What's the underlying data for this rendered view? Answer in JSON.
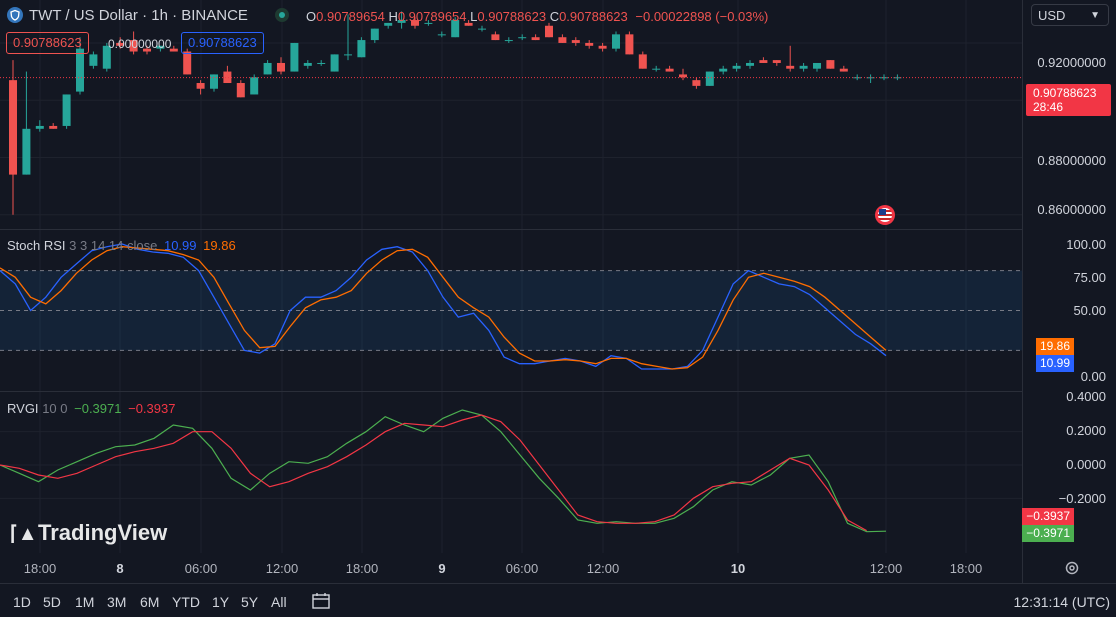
{
  "header": {
    "symbol": "TWT / US Dollar · 1h · BINANCE",
    "o_label": "O",
    "o_value": "0.90789654",
    "h_label": "H",
    "h_value": "0.90789654",
    "l_label": "L",
    "l_value": "0.90788623",
    "c_label": "C",
    "c_value": "0.90788623",
    "change": "−0.00022898 (−0.03%)",
    "sell_price": "0.90788623",
    "spread": "0.00000000",
    "buy_price": "0.90788623"
  },
  "currency_select": "USD",
  "price_axis": {
    "ticks": [
      "0.92000000",
      "0.90000000",
      "0.88000000",
      "0.86000000"
    ],
    "last_price": "0.90788623",
    "countdown": "28:46"
  },
  "stoch_rsi": {
    "title": "Stoch RSI",
    "params": "3 3 14 14 close",
    "k_value": "10.99",
    "d_value": "19.86",
    "ticks": [
      "100.00",
      "75.00",
      "50.00",
      "0.00"
    ]
  },
  "rvgi": {
    "title": "RVGI",
    "params": "10 0",
    "v1": "−0.3971",
    "v2": "−0.3937",
    "ticks": [
      "0.4000",
      "0.2000",
      "0.0000",
      "−0.2000"
    ]
  },
  "time_axis": {
    "labels": [
      {
        "t": "18:00",
        "bold": false
      },
      {
        "t": "8",
        "bold": true
      },
      {
        "t": "06:00",
        "bold": false
      },
      {
        "t": "12:00",
        "bold": false
      },
      {
        "t": "18:00",
        "bold": false
      },
      {
        "t": "9",
        "bold": true
      },
      {
        "t": "06:00",
        "bold": false
      },
      {
        "t": "12:00",
        "bold": false
      },
      {
        "t": "10",
        "bold": true
      },
      {
        "t": "12:00",
        "bold": false
      },
      {
        "t": "18:00",
        "bold": false
      }
    ]
  },
  "bottom_bar": {
    "ranges": [
      "1D",
      "5D",
      "1M",
      "3M",
      "6M",
      "YTD",
      "1Y",
      "5Y",
      "All"
    ],
    "clock": "12:31:14 (UTC)"
  },
  "watermark": "TradingView",
  "colors": {
    "up": "#26a69a",
    "down": "#ef5350",
    "k_line": "#2962ff",
    "d_line": "#ff6d00",
    "rvgi_1": "#4caf50",
    "rvgi_2": "#f23645"
  },
  "chart_data": [
    {
      "type": "candlestick",
      "title": "TWT / US Dollar · 1h · BINANCE",
      "ylim": [
        0.855,
        0.935
      ],
      "candles": [
        {
          "o": 0.907,
          "h": 0.914,
          "l": 0.86,
          "c": 0.874
        },
        {
          "o": 0.874,
          "h": 0.91,
          "l": 0.874,
          "c": 0.89
        },
        {
          "o": 0.89,
          "h": 0.893,
          "l": 0.889,
          "c": 0.891
        },
        {
          "o": 0.891,
          "h": 0.892,
          "l": 0.89,
          "c": 0.89
        },
        {
          "o": 0.891,
          "h": 0.902,
          "l": 0.89,
          "c": 0.902
        },
        {
          "o": 0.903,
          "h": 0.922,
          "l": 0.902,
          "c": 0.918
        },
        {
          "o": 0.912,
          "h": 0.917,
          "l": 0.911,
          "c": 0.916
        },
        {
          "o": 0.911,
          "h": 0.92,
          "l": 0.91,
          "c": 0.919
        },
        {
          "o": 0.92,
          "h": 0.922,
          "l": 0.918,
          "c": 0.919
        },
        {
          "o": 0.921,
          "h": 0.924,
          "l": 0.916,
          "c": 0.917
        },
        {
          "o": 0.918,
          "h": 0.919,
          "l": 0.916,
          "c": 0.917
        },
        {
          "o": 0.918,
          "h": 0.919,
          "l": 0.917,
          "c": 0.919
        },
        {
          "o": 0.918,
          "h": 0.919,
          "l": 0.917,
          "c": 0.917
        },
        {
          "o": 0.917,
          "h": 0.918,
          "l": 0.909,
          "c": 0.909
        },
        {
          "o": 0.906,
          "h": 0.907,
          "l": 0.902,
          "c": 0.904
        },
        {
          "o": 0.904,
          "h": 0.909,
          "l": 0.903,
          "c": 0.909
        },
        {
          "o": 0.91,
          "h": 0.912,
          "l": 0.906,
          "c": 0.906
        },
        {
          "o": 0.906,
          "h": 0.907,
          "l": 0.901,
          "c": 0.901
        },
        {
          "o": 0.902,
          "h": 0.909,
          "l": 0.902,
          "c": 0.908
        },
        {
          "o": 0.909,
          "h": 0.914,
          "l": 0.909,
          "c": 0.913
        },
        {
          "o": 0.913,
          "h": 0.915,
          "l": 0.909,
          "c": 0.91
        },
        {
          "o": 0.91,
          "h": 0.92,
          "l": 0.91,
          "c": 0.92
        },
        {
          "o": 0.912,
          "h": 0.914,
          "l": 0.911,
          "c": 0.913
        },
        {
          "o": 0.913,
          "h": 0.914,
          "l": 0.912,
          "c": 0.913
        },
        {
          "o": 0.91,
          "h": 0.916,
          "l": 0.91,
          "c": 0.916
        },
        {
          "o": 0.916,
          "h": 0.93,
          "l": 0.914,
          "c": 0.916
        },
        {
          "o": 0.915,
          "h": 0.922,
          "l": 0.915,
          "c": 0.921
        },
        {
          "o": 0.921,
          "h": 0.925,
          "l": 0.92,
          "c": 0.925
        },
        {
          "o": 0.926,
          "h": 0.927,
          "l": 0.925,
          "c": 0.927
        },
        {
          "o": 0.927,
          "h": 0.931,
          "l": 0.925,
          "c": 0.928
        },
        {
          "o": 0.928,
          "h": 0.929,
          "l": 0.925,
          "c": 0.926
        },
        {
          "o": 0.927,
          "h": 0.928,
          "l": 0.926,
          "c": 0.927
        },
        {
          "o": 0.923,
          "h": 0.924,
          "l": 0.922,
          "c": 0.923
        },
        {
          "o": 0.922,
          "h": 0.929,
          "l": 0.922,
          "c": 0.928
        },
        {
          "o": 0.927,
          "h": 0.928,
          "l": 0.926,
          "c": 0.926
        },
        {
          "o": 0.925,
          "h": 0.926,
          "l": 0.924,
          "c": 0.925
        },
        {
          "o": 0.923,
          "h": 0.924,
          "l": 0.921,
          "c": 0.921
        },
        {
          "o": 0.921,
          "h": 0.922,
          "l": 0.92,
          "c": 0.921
        },
        {
          "o": 0.922,
          "h": 0.923,
          "l": 0.921,
          "c": 0.922
        },
        {
          "o": 0.922,
          "h": 0.923,
          "l": 0.921,
          "c": 0.921
        },
        {
          "o": 0.926,
          "h": 0.927,
          "l": 0.922,
          "c": 0.922
        },
        {
          "o": 0.922,
          "h": 0.923,
          "l": 0.92,
          "c": 0.92
        },
        {
          "o": 0.921,
          "h": 0.922,
          "l": 0.919,
          "c": 0.92
        },
        {
          "o": 0.92,
          "h": 0.921,
          "l": 0.918,
          "c": 0.919
        },
        {
          "o": 0.919,
          "h": 0.92,
          "l": 0.917,
          "c": 0.918
        },
        {
          "o": 0.918,
          "h": 0.924,
          "l": 0.917,
          "c": 0.923
        },
        {
          "o": 0.923,
          "h": 0.924,
          "l": 0.916,
          "c": 0.916
        },
        {
          "o": 0.916,
          "h": 0.917,
          "l": 0.911,
          "c": 0.911
        },
        {
          "o": 0.911,
          "h": 0.912,
          "l": 0.91,
          "c": 0.911
        },
        {
          "o": 0.911,
          "h": 0.912,
          "l": 0.91,
          "c": 0.91
        },
        {
          "o": 0.909,
          "h": 0.911,
          "l": 0.907,
          "c": 0.908
        },
        {
          "o": 0.907,
          "h": 0.908,
          "l": 0.904,
          "c": 0.905
        },
        {
          "o": 0.905,
          "h": 0.91,
          "l": 0.905,
          "c": 0.91
        },
        {
          "o": 0.91,
          "h": 0.912,
          "l": 0.909,
          "c": 0.911
        },
        {
          "o": 0.911,
          "h": 0.913,
          "l": 0.91,
          "c": 0.912
        },
        {
          "o": 0.912,
          "h": 0.914,
          "l": 0.911,
          "c": 0.913
        },
        {
          "o": 0.914,
          "h": 0.915,
          "l": 0.913,
          "c": 0.913
        },
        {
          "o": 0.914,
          "h": 0.914,
          "l": 0.912,
          "c": 0.913
        },
        {
          "o": 0.912,
          "h": 0.919,
          "l": 0.91,
          "c": 0.911
        },
        {
          "o": 0.911,
          "h": 0.913,
          "l": 0.91,
          "c": 0.912
        },
        {
          "o": 0.911,
          "h": 0.913,
          "l": 0.91,
          "c": 0.913
        },
        {
          "o": 0.914,
          "h": 0.914,
          "l": 0.911,
          "c": 0.911
        },
        {
          "o": 0.911,
          "h": 0.912,
          "l": 0.91,
          "c": 0.91
        },
        {
          "o": 0.908,
          "h": 0.909,
          "l": 0.907,
          "c": 0.908
        },
        {
          "o": 0.908,
          "h": 0.909,
          "l": 0.906,
          "c": 0.908
        },
        {
          "o": 0.908,
          "h": 0.909,
          "l": 0.907,
          "c": 0.908
        },
        {
          "o": 0.908,
          "h": 0.909,
          "l": 0.907,
          "c": 0.908
        }
      ]
    },
    {
      "type": "line",
      "title": "Stoch RSI",
      "ylim": [
        0,
        100
      ],
      "bands": [
        20,
        80
      ],
      "series": [
        {
          "name": "K",
          "values": [
            80,
            70,
            50,
            60,
            75,
            85,
            95,
            98,
            100,
            96,
            94,
            93,
            90,
            80,
            60,
            40,
            20,
            18,
            25,
            50,
            60,
            60,
            65,
            75,
            88,
            96,
            98,
            94,
            80,
            60,
            45,
            48,
            35,
            15,
            10,
            10,
            12,
            14,
            12,
            8,
            16,
            14,
            6,
            6,
            6,
            8,
            20,
            45,
            70,
            80,
            75,
            70,
            68,
            62,
            52,
            42,
            32,
            25,
            16
          ]
        },
        {
          "name": "D",
          "values": [
            82,
            75,
            60,
            55,
            65,
            78,
            88,
            95,
            98,
            97,
            96,
            95,
            92,
            88,
            75,
            55,
            35,
            22,
            23,
            38,
            52,
            58,
            60,
            65,
            78,
            88,
            95,
            96,
            90,
            75,
            60,
            52,
            45,
            30,
            18,
            12,
            12,
            13,
            12,
            10,
            14,
            14,
            10,
            8,
            6,
            7,
            15,
            35,
            58,
            75,
            78,
            75,
            72,
            68,
            60,
            50,
            40,
            30,
            20
          ]
        }
      ]
    },
    {
      "type": "line",
      "title": "RVGI",
      "ylim": [
        -0.42,
        0.42
      ],
      "series": [
        {
          "name": "RVGI",
          "values": [
            0.0,
            -0.05,
            -0.1,
            -0.03,
            0.02,
            0.07,
            0.11,
            0.12,
            0.16,
            0.24,
            0.22,
            0.1,
            -0.08,
            -0.15,
            -0.05,
            0.02,
            0.01,
            0.05,
            0.13,
            0.2,
            0.29,
            0.24,
            0.2,
            0.28,
            0.33,
            0.3,
            0.2,
            0.06,
            -0.08,
            -0.2,
            -0.33,
            -0.35,
            -0.34,
            -0.35,
            -0.35,
            -0.32,
            -0.25,
            -0.15,
            -0.1,
            -0.12,
            -0.06,
            0.04,
            0.06,
            -0.1,
            -0.35,
            -0.4,
            -0.3971
          ]
        },
        {
          "name": "Signal",
          "values": [
            0.0,
            -0.02,
            -0.06,
            -0.08,
            -0.05,
            0.0,
            0.05,
            0.08,
            0.1,
            0.13,
            0.2,
            0.2,
            0.1,
            -0.05,
            -0.13,
            -0.1,
            -0.05,
            -0.01,
            0.05,
            0.12,
            0.2,
            0.25,
            0.24,
            0.23,
            0.27,
            0.3,
            0.26,
            0.15,
            0.0,
            -0.15,
            -0.3,
            -0.34,
            -0.35,
            -0.35,
            -0.34,
            -0.3,
            -0.2,
            -0.13,
            -0.11,
            -0.1,
            -0.03,
            0.04,
            0.0,
            -0.15,
            -0.33,
            -0.3937
          ]
        }
      ]
    }
  ]
}
